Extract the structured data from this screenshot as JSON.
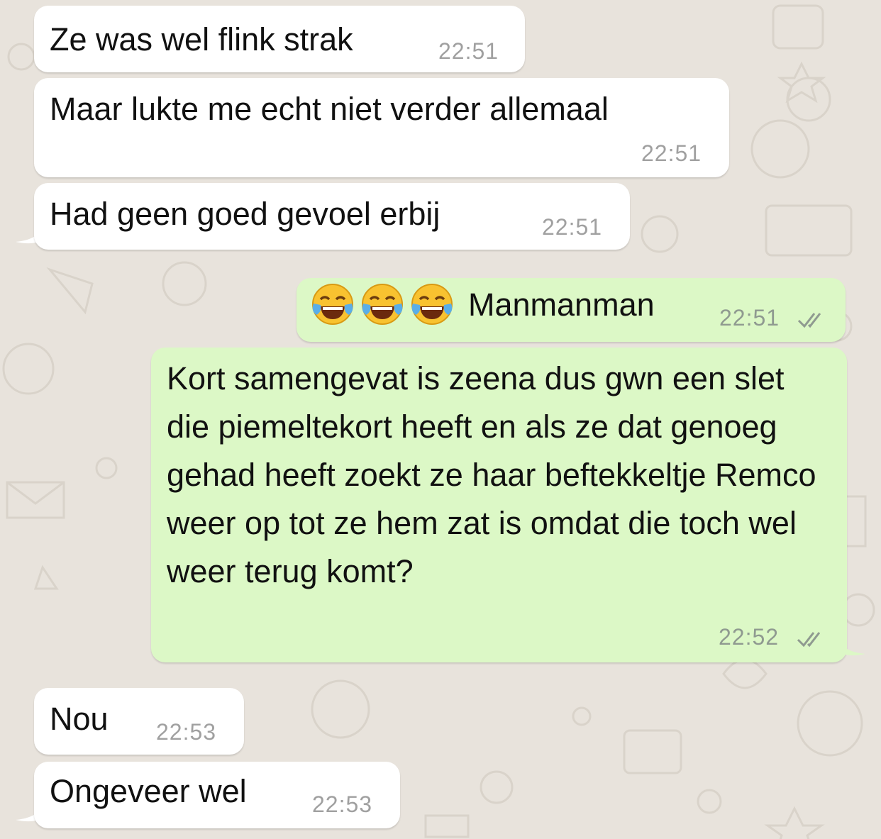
{
  "colors": {
    "incoming_bubble": "#ffffff",
    "outgoing_bubble": "#dcf8c6",
    "timestamp_gray": "#a0a0a0",
    "read_ticks": "#8f9a90",
    "wallpaper": "#e8e3dc"
  },
  "messages": [
    {
      "direction": "incoming",
      "text": "Ze was wel flink strak",
      "time": "22:51"
    },
    {
      "direction": "incoming",
      "text": "Maar lukte me echt niet verder allemaal",
      "time": "22:51"
    },
    {
      "direction": "incoming",
      "text": "Had geen goed gevoel erbij",
      "time": "22:51"
    },
    {
      "direction": "outgoing",
      "emoji": "face-with-tears-of-joy x3",
      "text": "Manmanman",
      "time": "22:51",
      "status": "read"
    },
    {
      "direction": "outgoing",
      "text": "Kort samengevat is zeena dus gwn een slet die piemeltekort heeft en als ze dat genoeg gehad heeft zoekt ze haar beftekkeltje Remco weer op tot ze hem zat is omdat die toch wel weer terug komt?",
      "time": "22:52",
      "status": "read"
    },
    {
      "direction": "incoming",
      "text": "Nou",
      "time": "22:53"
    },
    {
      "direction": "incoming",
      "text": "Ongeveer wel",
      "time": "22:53"
    }
  ],
  "icons": {
    "read_status": "double-check-icon",
    "emoji": "face-with-tears-of-joy-emoji"
  }
}
